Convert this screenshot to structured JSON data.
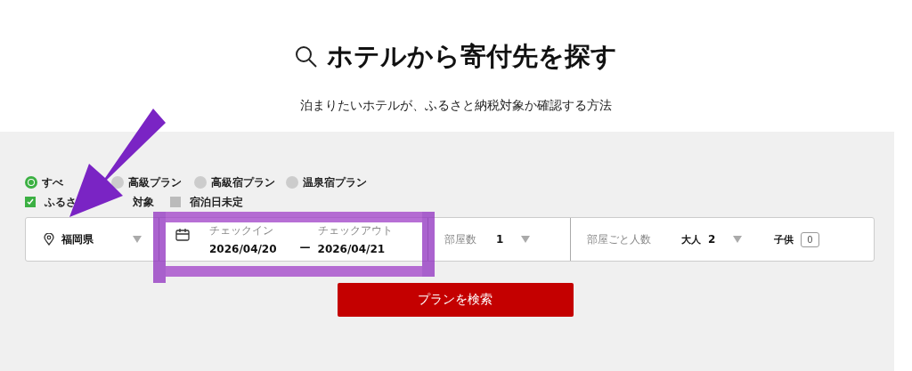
{
  "header": {
    "title": "ホテルから寄付先を探す",
    "subtitle": "泊まりたいホテルが、ふるさと納税対象か確認する方法"
  },
  "plan_filters": [
    {
      "label": "すべ",
      "selected": true
    },
    {
      "label": "高級プラン",
      "selected": false
    },
    {
      "label": "高級宿プラン",
      "selected": false
    },
    {
      "label": "温泉宿プラン",
      "selected": false
    }
  ],
  "options": [
    {
      "label": "ふるさ",
      "tail": "対象",
      "checked": true
    },
    {
      "label": "宿泊日未定",
      "checked": false
    }
  ],
  "search_bar": {
    "prefecture": "福岡県",
    "checkin_label": "チェックイン",
    "checkin": "2026/04/20",
    "separator": "—",
    "checkout_label": "チェックアウト",
    "checkout": "2026/04/21",
    "rooms_label": "部屋数",
    "rooms": "1",
    "guests_label": "部屋ごと人数",
    "adults_label": "大人",
    "adults": "2",
    "children_label": "子供",
    "children": "0"
  },
  "search_button": "プランを検索"
}
